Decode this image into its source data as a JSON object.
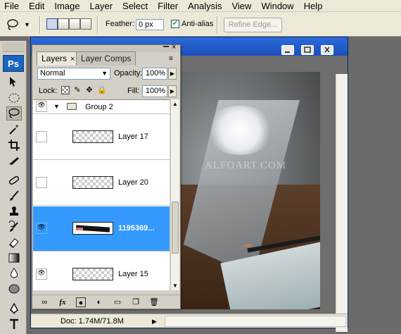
{
  "menubar": {
    "items": [
      "File",
      "Edit",
      "Image",
      "Layer",
      "Select",
      "Filter",
      "Analysis",
      "View",
      "Window",
      "Help"
    ]
  },
  "options": {
    "feather_label": "Feather:",
    "feather_value": "0 px",
    "antialias_label": "Anti-alias",
    "antialias_checked": true,
    "refine_edge_label": "Refine Edge..."
  },
  "tools": {
    "logo": "Ps"
  },
  "document": {
    "watermark": "ALFOART.COM",
    "doc_size": "Doc: 1.74M/71.8M"
  },
  "layers_panel": {
    "tab_layers": "Layers",
    "tab_layer_comps": "Layer Comps",
    "blend_mode": "Normal",
    "opacity_label": "Opacity:",
    "opacity_value": "100%",
    "lock_label": "Lock:",
    "fill_label": "Fill:",
    "fill_value": "100%",
    "group_name": "Group 2",
    "layers": [
      {
        "name": "Layer 17",
        "visible": false,
        "selected": false
      },
      {
        "name": "Layer 20",
        "visible": false,
        "selected": false
      },
      {
        "name": "1195369...",
        "visible": true,
        "selected": true
      },
      {
        "name": "Layer 15",
        "visible": true,
        "selected": false
      }
    ]
  }
}
